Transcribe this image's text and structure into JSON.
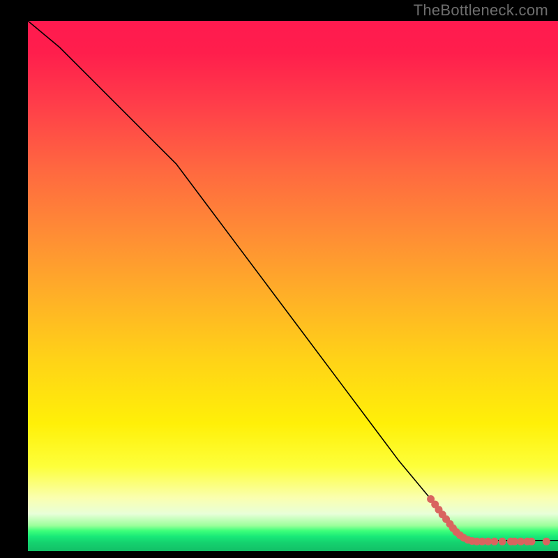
{
  "attribution": "TheBottleneck.com",
  "chart_data": {
    "type": "line",
    "title": "",
    "xlabel": "",
    "ylabel": "",
    "xlim": [
      0,
      1
    ],
    "ylim": [
      0,
      1
    ],
    "curve": [
      {
        "x": 0.0,
        "y": 1.0
      },
      {
        "x": 0.06,
        "y": 0.95
      },
      {
        "x": 0.12,
        "y": 0.89
      },
      {
        "x": 0.18,
        "y": 0.83
      },
      {
        "x": 0.24,
        "y": 0.77
      },
      {
        "x": 0.28,
        "y": 0.73
      },
      {
        "x": 0.34,
        "y": 0.65
      },
      {
        "x": 0.4,
        "y": 0.57
      },
      {
        "x": 0.46,
        "y": 0.49
      },
      {
        "x": 0.52,
        "y": 0.41
      },
      {
        "x": 0.58,
        "y": 0.33
      },
      {
        "x": 0.64,
        "y": 0.25
      },
      {
        "x": 0.7,
        "y": 0.17
      },
      {
        "x": 0.75,
        "y": 0.11
      },
      {
        "x": 0.8,
        "y": 0.05
      },
      {
        "x": 0.82,
        "y": 0.03
      },
      {
        "x": 0.83,
        "y": 0.02
      },
      {
        "x": 0.84,
        "y": 0.02
      },
      {
        "x": 0.86,
        "y": 0.02
      },
      {
        "x": 0.9,
        "y": 0.02
      },
      {
        "x": 0.95,
        "y": 0.02
      },
      {
        "x": 1.0,
        "y": 0.02
      }
    ],
    "markers": [
      {
        "x": 0.76,
        "y": 0.098
      },
      {
        "x": 0.768,
        "y": 0.088
      },
      {
        "x": 0.775,
        "y": 0.078
      },
      {
        "x": 0.782,
        "y": 0.069
      },
      {
        "x": 0.789,
        "y": 0.06
      },
      {
        "x": 0.796,
        "y": 0.051
      },
      {
        "x": 0.802,
        "y": 0.043
      },
      {
        "x": 0.808,
        "y": 0.036
      },
      {
        "x": 0.815,
        "y": 0.03
      },
      {
        "x": 0.822,
        "y": 0.025
      },
      {
        "x": 0.83,
        "y": 0.021
      },
      {
        "x": 0.838,
        "y": 0.019
      },
      {
        "x": 0.847,
        "y": 0.018
      },
      {
        "x": 0.857,
        "y": 0.018
      },
      {
        "x": 0.868,
        "y": 0.018
      },
      {
        "x": 0.88,
        "y": 0.018
      },
      {
        "x": 0.895,
        "y": 0.018
      },
      {
        "x": 0.911,
        "y": 0.018
      },
      {
        "x": 0.918,
        "y": 0.018
      },
      {
        "x": 0.93,
        "y": 0.018
      },
      {
        "x": 0.942,
        "y": 0.018
      },
      {
        "x": 0.95,
        "y": 0.018
      },
      {
        "x": 0.978,
        "y": 0.018
      }
    ]
  }
}
